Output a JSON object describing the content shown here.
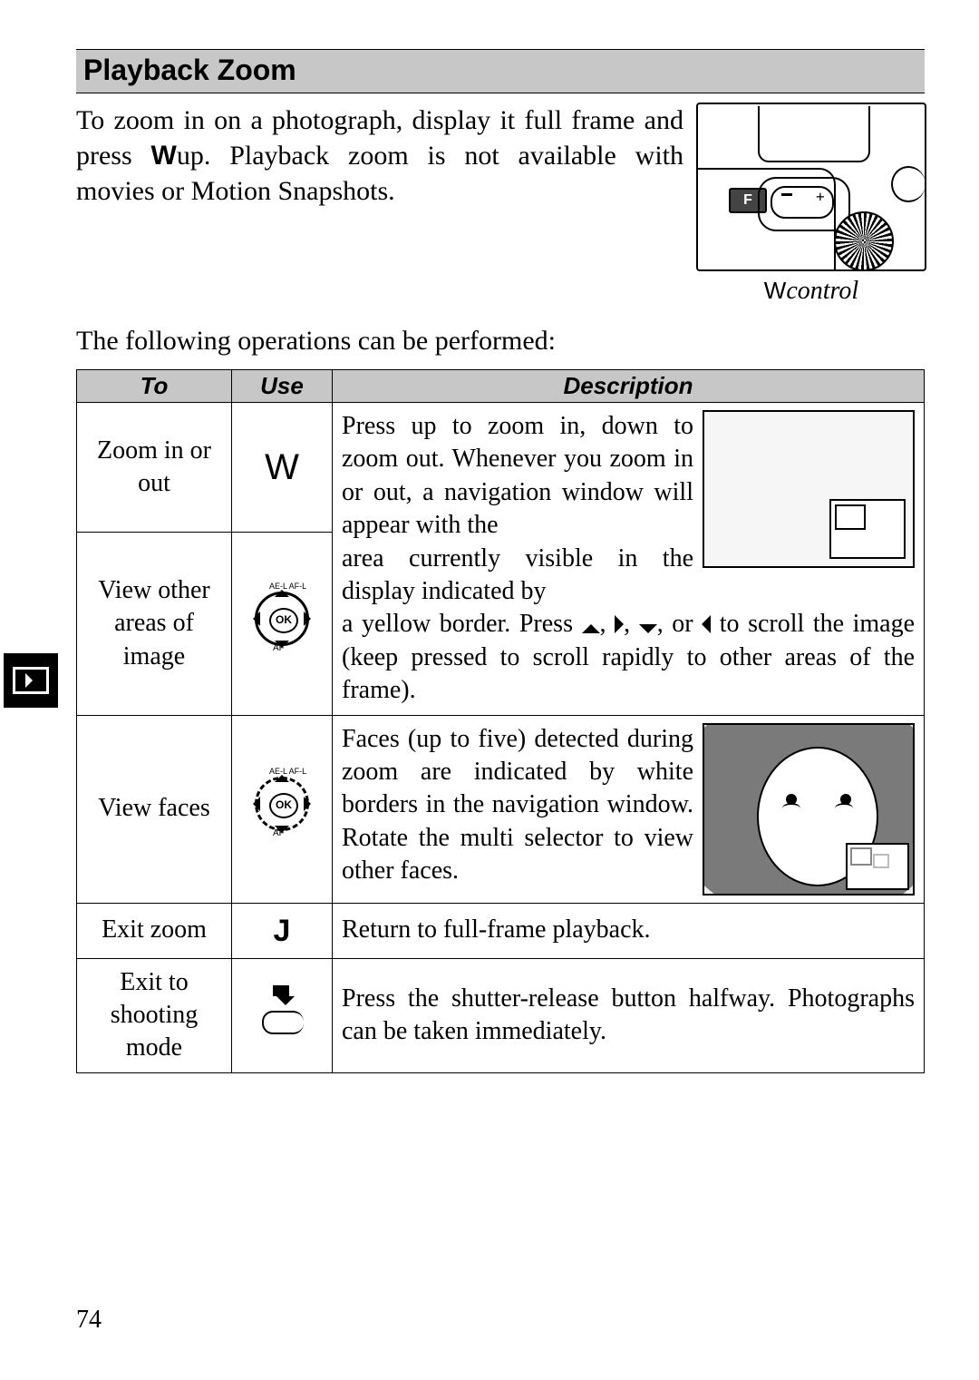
{
  "heading": "Playback Zoom",
  "intro_text_1": "To zoom in on a photograph, display it full frame and press ",
  "intro_w_label": "W",
  "intro_text_2": "up. Playback zoom is not available with movies or Motion Snapshots.",
  "control_caption": "Wcontrol",
  "operations_intro": "The following operations can be performed:",
  "table": {
    "headers": {
      "to": "To",
      "use": "Use",
      "desc": "Description"
    },
    "rows": {
      "zoom": {
        "to": "Zoom in or out",
        "use": "W",
        "desc_a": "Press up to zoom in, down to zoom out. Whenever you zoom in or out, a navigation win­dow will appear with the "
      },
      "view_other": {
        "to": "View other areas of image",
        "desc_b1": "area currently visible in the display indicated by ",
        "desc_b2": "a yellow border. Press ",
        "desc_b3": " to scroll the image (keep pressed to scroll rapidly to other areas of the frame).",
        "arrows_sep": ", ",
        "arrows_or": ", or "
      },
      "view_faces": {
        "to": "View faces",
        "desc": "Faces (up to five) detected during zoom are indicated by white borders in the navigation window. Rotate the multi selector to view other faces."
      },
      "exit_zoom": {
        "to": "Exit zoom",
        "use": "J",
        "desc": "Return to full-frame playback."
      },
      "exit_shoot": {
        "to": "Exit to shooting mode",
        "desc": "Press the shutter-release button halfway. Photo­graphs can be taken immediately."
      }
    }
  },
  "icons": {
    "ok": "OK",
    "ael": "AE-L\nAF-L",
    "af": "AF",
    "F": "F"
  },
  "page_number": "74"
}
